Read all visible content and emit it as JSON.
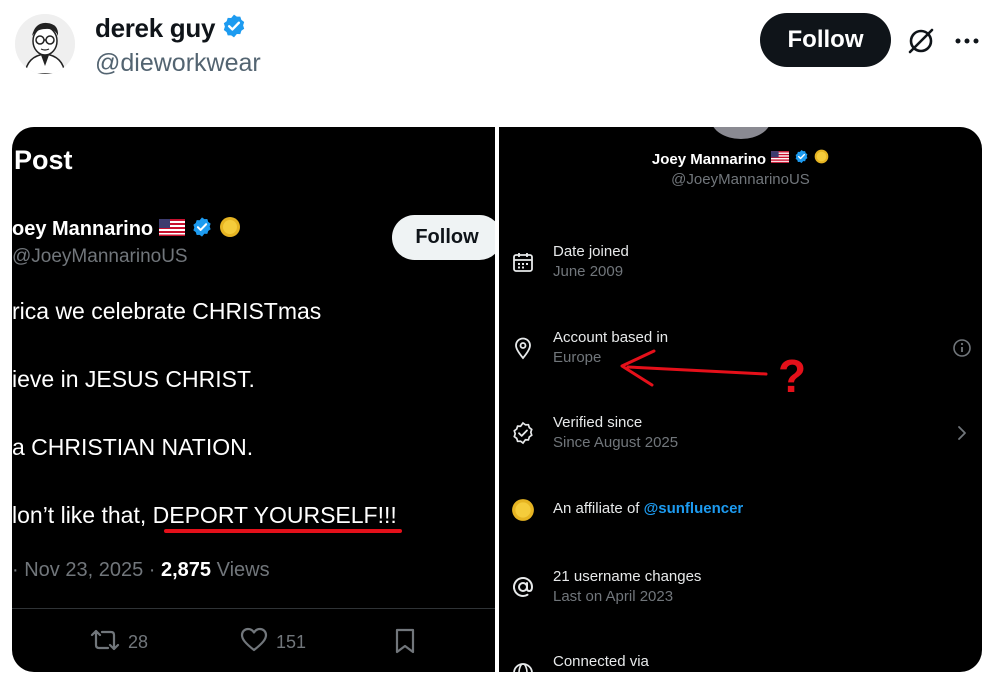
{
  "author": {
    "display_name": "derek guy",
    "handle": "@dieworkwear",
    "verified": true
  },
  "actions": {
    "follow_label": "Follow",
    "grok_icon": "grok-icon",
    "more_icon": "more-icon"
  },
  "left_screenshot": {
    "title": "Post",
    "name": "oey Mannarino",
    "handle": "@JoeyMannarinoUS",
    "follow_label": "Follow",
    "lines": [
      "rica we celebrate CHRISTmas",
      "ieve in JESUS CHRIST.",
      "a CHRISTIAN NATION.",
      "lon’t like that, ",
      "DEPORT YOURSELF!!!"
    ],
    "meta_date": "· Nov 23, 2025 · ",
    "views_count": "2,875",
    "views_label": " Views",
    "retweet_count": "28",
    "like_count": "151"
  },
  "right_screenshot": {
    "name": "Joey Mannarino",
    "handle": "@JoeyMannarinoUS",
    "rows": [
      {
        "title": "Date joined",
        "sub": "June 2009"
      },
      {
        "title": "Account based in",
        "sub": "Europe"
      },
      {
        "title": "Verified since",
        "sub": "Since August 2025"
      },
      {
        "title": "An affiliate of ",
        "link": "@sunfluencer"
      },
      {
        "title": "21 username changes",
        "sub": "Last on April 2023"
      },
      {
        "title": "Connected via"
      }
    ],
    "annotation": "?"
  },
  "colors": {
    "accent": "#1d9bf0",
    "annotation_red": "#e5101a"
  }
}
